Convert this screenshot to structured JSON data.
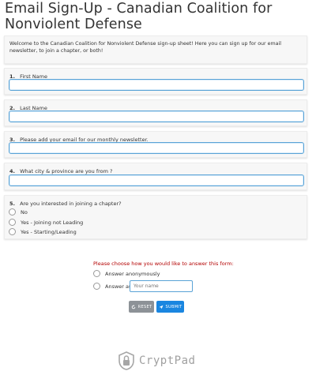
{
  "form": {
    "title": "Email Sign-Up - Canadian Coalition for Nonviolent Defense",
    "intro": "Welcome to the Canadian Coalition for Nonviolent Defense sign-up sheet! Here you can sign up for our email newsletter, to join a chapter, or both!",
    "questions": [
      {
        "num": "1.",
        "label": "First Name",
        "value": ""
      },
      {
        "num": "2.",
        "label": "Last Name",
        "value": ""
      },
      {
        "num": "3.",
        "label": "Please add your email for our monthly newsletter.",
        "value": ""
      },
      {
        "num": "4.",
        "label": "What city & province are you from ?",
        "value": ""
      },
      {
        "num": "5.",
        "label": "Are you interested in joining a chapter?",
        "options": [
          "No",
          "Yes - Joining not Leading",
          "Yes - Starting/Leading"
        ]
      }
    ]
  },
  "answer_mode": {
    "prompt": "Please choose how you would like to answer this form:",
    "anonymous_label": "Answer anonymously",
    "answer_as_label": "Answer as",
    "name_placeholder": "Your name"
  },
  "actions": {
    "reset_label": "RESET",
    "submit_label": "SUBMIT"
  },
  "footer": {
    "brand": "CryptPad"
  }
}
